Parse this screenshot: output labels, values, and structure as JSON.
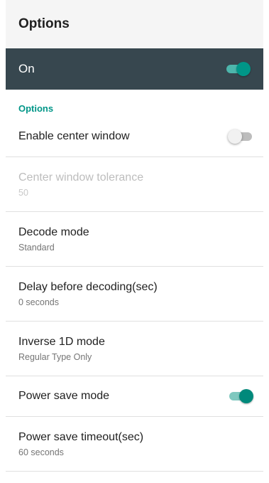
{
  "app_bar": {
    "title": "Options"
  },
  "master_switch": {
    "label": "On",
    "checked": true
  },
  "section": {
    "header": "Options"
  },
  "settings": [
    {
      "title": "Enable center window",
      "toggle": false
    },
    {
      "title": "Center window tolerance",
      "summary": "50",
      "disabled": true
    },
    {
      "title": "Decode mode",
      "summary": "Standard"
    },
    {
      "title": "Delay before decoding(sec)",
      "summary": "0 seconds"
    },
    {
      "title": "Inverse 1D mode",
      "summary": "Regular Type Only"
    },
    {
      "title": "Power save mode",
      "toggle": true
    },
    {
      "title": "Power save timeout(sec)",
      "summary": "60 seconds"
    }
  ],
  "colors": {
    "accent": "#009688",
    "master_bar": "#37474f",
    "app_bar": "#f5f5f5"
  }
}
